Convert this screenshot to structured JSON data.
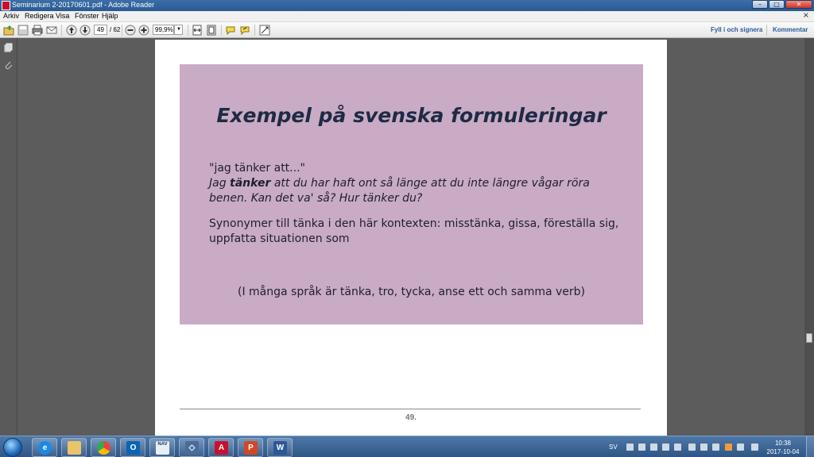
{
  "window": {
    "title": "Seminarium 2-20170601.pdf - Adobe Reader",
    "minimize": "–",
    "maximize": "□",
    "close": "✕"
  },
  "menu": {
    "items": [
      {
        "label": "Arkiv"
      },
      {
        "label": "Redigera"
      },
      {
        "label": "Visa"
      },
      {
        "label": "Fönster"
      },
      {
        "label": "Hjälp"
      }
    ],
    "doc_close": "×"
  },
  "toolbar": {
    "page_current": "49",
    "page_total": "/ 62",
    "zoom": "99,9%",
    "fill_sign": "Fyll i och signera",
    "comment": "Kommentar",
    "icons": [
      "open-icon",
      "save-icon",
      "print-icon",
      "email-icon",
      "prev-page-icon",
      "next-page-icon",
      "zoom-out-icon",
      "zoom-in-icon",
      "fit-width-icon",
      "fit-page-icon",
      "comment-icon",
      "highlight-icon",
      "tools-icon"
    ]
  },
  "document": {
    "slide": {
      "title": "Exempel på svenska formuleringar",
      "quote": "\"jag tänker att...\"",
      "example_start": "Jag ",
      "example_bold": "tänker",
      "example_rest": " att du har haft ont så länge att du inte längre vågar röra benen. Kan det va' så? Hur tänker du?",
      "synonyms": "Synonymer till tänka i den här kontexten: misstänka, gissa, föreställa sig, uppfatta situationen som",
      "note": "(I många språk är tänka, tro, tycka, anse ett och samma verb)",
      "background": "#c9abc5"
    },
    "page_number": "49."
  },
  "taskbar": {
    "apps": [
      {
        "name": "internet-explorer",
        "glyph": "e",
        "color": "#1e88e5"
      },
      {
        "name": "file-explorer",
        "glyph": "",
        "color": "#e9c46a"
      },
      {
        "name": "chrome",
        "glyph": "",
        "color": "#34a853"
      },
      {
        "name": "outlook",
        "glyph": "O",
        "color": "#0a64b4"
      },
      {
        "name": "nav",
        "glyph": "NAV",
        "color": "#e8eef6"
      },
      {
        "name": "app-diamond",
        "glyph": "◇",
        "color": "#4a6c9a"
      },
      {
        "name": "adobe-reader",
        "glyph": "A",
        "color": "#c8102e"
      },
      {
        "name": "powerpoint",
        "glyph": "P",
        "color": "#d24726"
      },
      {
        "name": "word",
        "glyph": "W",
        "color": "#2b579a"
      }
    ],
    "language": "SV",
    "time": "10:38",
    "date": "2017-10-04"
  }
}
